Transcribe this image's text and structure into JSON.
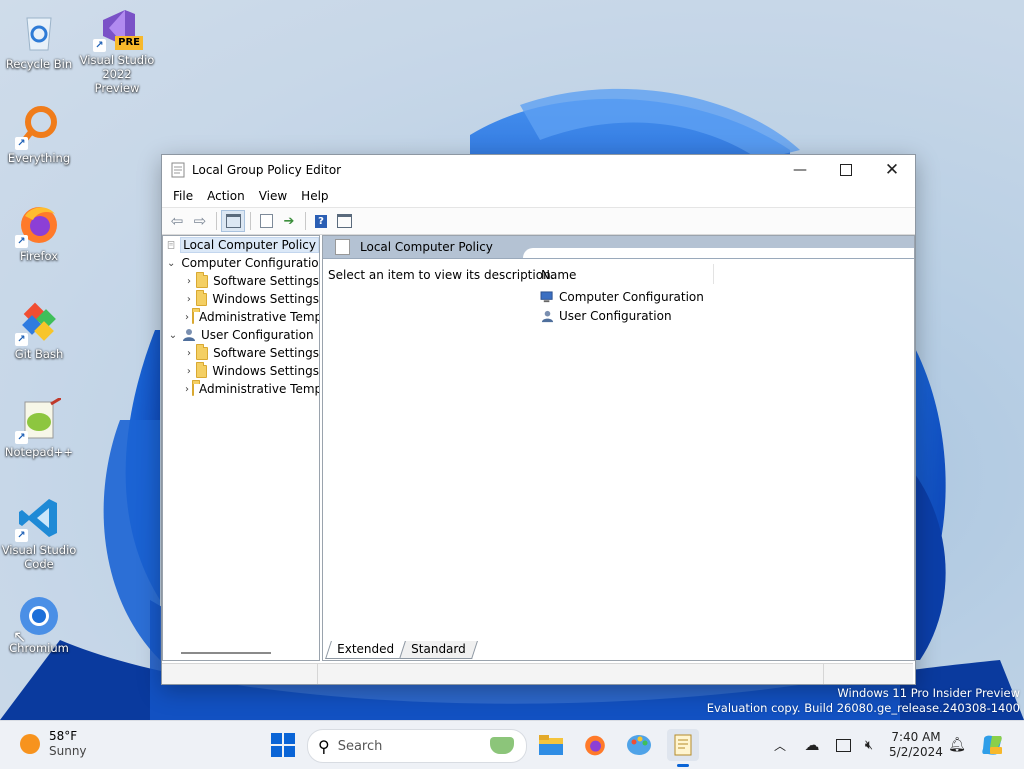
{
  "desktop": {
    "icons": [
      {
        "label_line1": "Recycle Bin",
        "label_line2": "",
        "icon": "recycle-bin-icon"
      },
      {
        "label_line1": "Visual Studio",
        "label_line2": "2022 Preview",
        "badge": "PRE",
        "icon": "visual-studio-icon"
      },
      {
        "label_line1": "Everything",
        "label_line2": "",
        "icon": "everything-search-icon"
      },
      {
        "label_line1": "Firefox",
        "label_line2": "",
        "icon": "firefox-icon"
      },
      {
        "label_line1": "Git Bash",
        "label_line2": "",
        "icon": "git-bash-icon"
      },
      {
        "label_line1": "Notepad++",
        "label_line2": "",
        "icon": "notepad-plus-plus-icon"
      },
      {
        "label_line1": "Visual Studio",
        "label_line2": "Code",
        "icon": "vscode-icon"
      },
      {
        "label_line1": "Chromium",
        "label_line2": "",
        "icon": "chromium-icon"
      }
    ]
  },
  "window": {
    "title": "Local Group Policy Editor",
    "menu": [
      "File",
      "Action",
      "View",
      "Help"
    ],
    "tree": {
      "root": "Local Computer Policy",
      "nodes": [
        {
          "label": "Computer Configuration",
          "children": [
            "Software Settings",
            "Windows Settings",
            "Administrative Templates"
          ]
        },
        {
          "label": "User Configuration",
          "children": [
            "Software Settings",
            "Windows Settings",
            "Administrative Templates"
          ]
        }
      ]
    },
    "details": {
      "header_title": "Local Computer Policy",
      "description": "Select an item to view its description.",
      "column_name": "Name",
      "items": [
        "Computer Configuration",
        "User Configuration"
      ]
    },
    "tabs": [
      "Extended",
      "Standard"
    ],
    "active_tab": "Extended"
  },
  "watermark": {
    "line1": "Windows 11 Pro Insider Preview",
    "line2": "Evaluation copy. Build 26080.ge_release.240308-1400"
  },
  "taskbar": {
    "weather_temp": "58°F",
    "weather_cond": "Sunny",
    "search_placeholder": "Search",
    "time": "7:40 AM",
    "date": "5/2/2024"
  },
  "colors": {
    "header_band": "#b4c2d3",
    "selection": "#dbe8f7",
    "taskbar": "#eef1f6",
    "windows_blue": "#0a64d6"
  }
}
